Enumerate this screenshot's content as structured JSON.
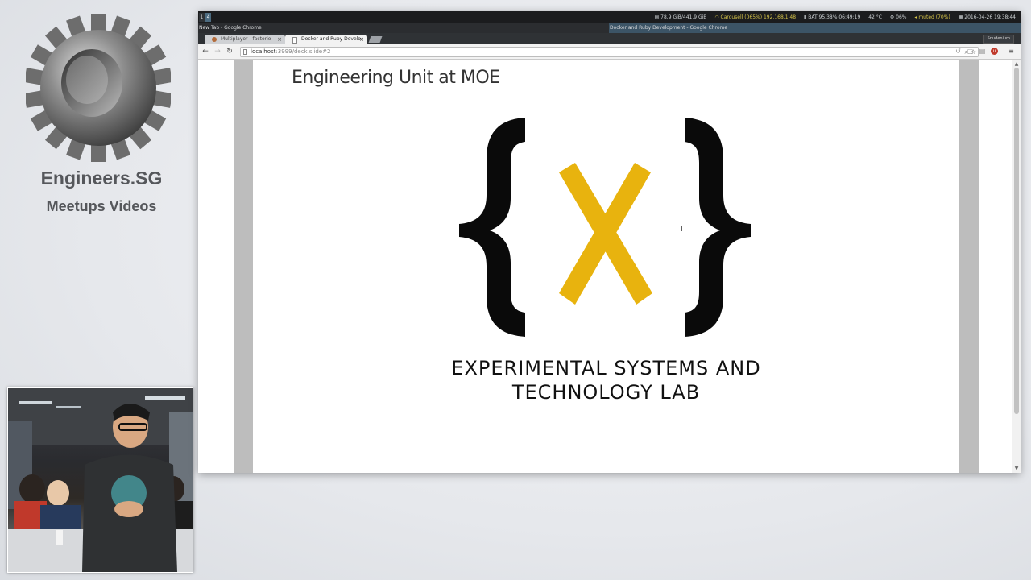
{
  "branding": {
    "title": "Engineers.SG",
    "subtitle": "Meetups Videos",
    "gear_icon": "gear-icon"
  },
  "topbar": {
    "workspaces": [
      "1",
      "4"
    ],
    "memory": "78.9 GiB/441.9 GiB",
    "wifi": "Carousell (065%) 192.168.1.48",
    "battery": "BAT 95.38% 06:49:19",
    "temperature": "42 °C",
    "cpu": "06%",
    "volume": "muted (70%)",
    "datetime": "2016-04-26 19:38:44"
  },
  "titlebar": {
    "left_window": "New Tab - Google Chrome",
    "right_window": "Docker and Ruby Development - Google Chrome"
  },
  "tabs": [
    {
      "label": "Multiplayer - factorio",
      "active": false,
      "favicon_color": "#b36b3a"
    },
    {
      "label": "Docker and Ruby Develo",
      "active": true,
      "favicon_color": "#888888"
    }
  ],
  "profile_button": "Snudenium",
  "omnibox": {
    "url_host": "localhost",
    "url_rest": ":3999/deck.slide#2"
  },
  "slide": {
    "title": "Engineering Unit at MOE",
    "lab_line1": "EXPERIMENTAL SYSTEMS AND",
    "lab_line2": "TECHNOLOGY LAB",
    "logo_brace_color": "#0a0a0a",
    "logo_x_color": "#e8b30e"
  },
  "colors": {
    "accent_titlebar": "#3c5466",
    "workspace_active": "#4c6b80"
  }
}
